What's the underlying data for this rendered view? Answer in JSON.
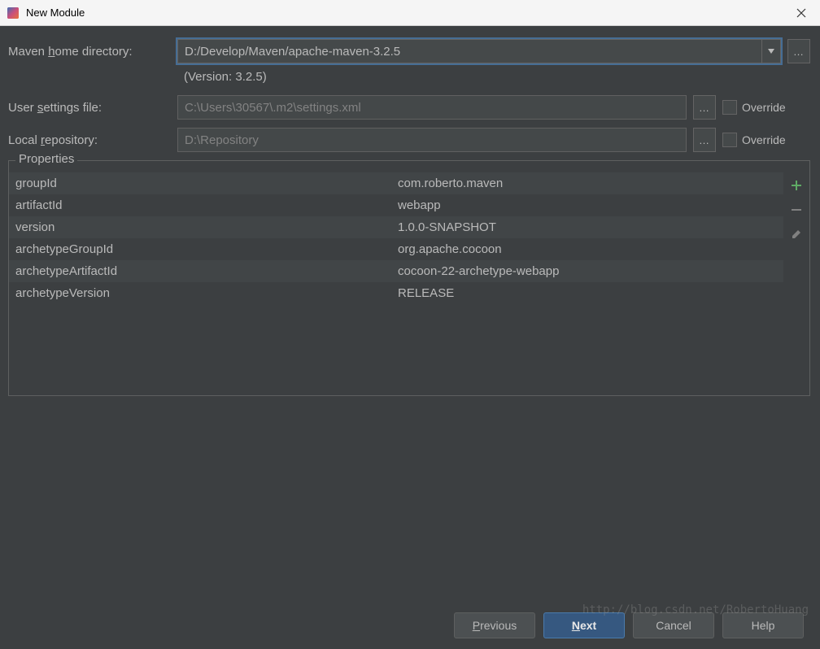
{
  "window": {
    "title": "New Module"
  },
  "labels": {
    "maven_home_pre": "Maven ",
    "maven_home_ul": "h",
    "maven_home_post": "ome directory:",
    "settings_pre": "User ",
    "settings_ul": "s",
    "settings_post": "ettings file:",
    "repo_pre": "Local ",
    "repo_ul": "r",
    "repo_post": "epository:",
    "override": "Override",
    "properties": "Properties"
  },
  "fields": {
    "maven_home": "D:/Develop/Maven/apache-maven-3.2.5",
    "version_text": "(Version: 3.2.5)",
    "settings_file": "C:\\Users\\30567\\.m2\\settings.xml",
    "local_repo": "D:\\Repository"
  },
  "properties": [
    {
      "key": "groupId",
      "value": "com.roberto.maven"
    },
    {
      "key": "artifactId",
      "value": "webapp"
    },
    {
      "key": "version",
      "value": "1.0.0-SNAPSHOT"
    },
    {
      "key": "archetypeGroupId",
      "value": "org.apache.cocoon"
    },
    {
      "key": "archetypeArtifactId",
      "value": "cocoon-22-archetype-webapp"
    },
    {
      "key": "archetypeVersion",
      "value": "RELEASE"
    }
  ],
  "buttons": {
    "previous_ul": "P",
    "previous_post": "revious",
    "next_ul": "N",
    "next_post": "ext",
    "cancel": "Cancel",
    "help": "Help"
  },
  "watermark": "http://blog.csdn.net/RobertoHuang"
}
